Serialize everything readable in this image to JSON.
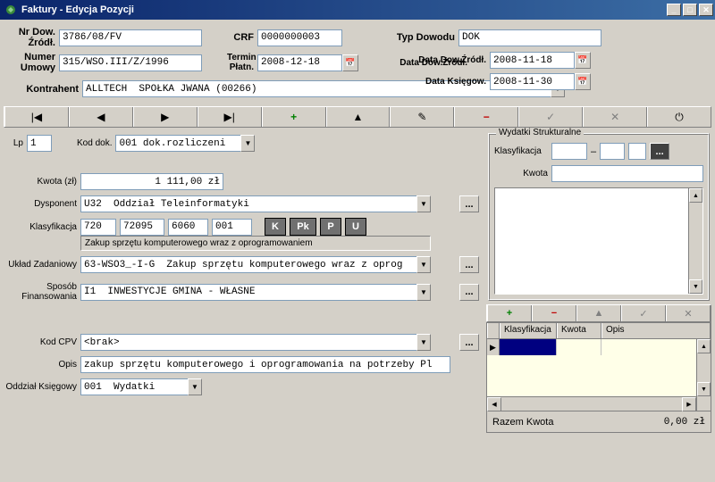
{
  "window": {
    "title": "Faktury - Edycja Pozycji"
  },
  "header": {
    "nrdow_label": "Nr Dow. Źródł.",
    "nrdow_value": "3786/08/FV",
    "crf_label": "CRF",
    "crf_value": "0000000003",
    "typdow_label": "Typ Dowodu",
    "typdow_value": "DOK",
    "numumowy_label": "Numer Umowy",
    "numumowy_value": "315/WSO.III/Z/1996",
    "termin_label": "Termin Płatn.",
    "termin_value": "2008-12-18",
    "datadow_label": "Data Dow.Źródł.",
    "datadow_value": "2008-11-18",
    "dataksieg_label": "Data Księgow.",
    "dataksieg_value": "2008-11-30",
    "kontrahent_label": "Kontrahent",
    "kontrahent_value": "ALLTECH  SPÓŁKA JWANA (00266)"
  },
  "toolbar": {
    "first": "⏮",
    "prev": "◀",
    "next": "▶",
    "last": "⏭",
    "add": "+",
    "up": "▲",
    "edit": "✎",
    "delete": "−",
    "ok": "✓",
    "cancel": "✕",
    "exit": "⎋"
  },
  "form": {
    "lp_label": "Lp",
    "lp_value": "1",
    "koddok_label": "Kod dok.",
    "koddok_value": "001 dok.rozliczeni",
    "kwota_label": "Kwota (zł)",
    "kwota_value": "1 111,00 zł",
    "dysponent_label": "Dysponent",
    "dysponent_value": "U32  Oddział Teleinformatyki",
    "klas_label": "Klasyfikacja",
    "klas_a": "720",
    "klas_b": "72095",
    "klas_c": "6060",
    "klas_d": "001",
    "klas_desc": "Zakup sprzętu komputerowego wraz z oprogramowaniem",
    "btn_K": "K",
    "btn_Pk": "Pk",
    "btn_P": "P",
    "btn_U": "U",
    "uklad_label": "Układ Zadaniowy",
    "uklad_value": "63-WSO3_-I-G  Zakup sprzętu komputerowego wraz z oprog",
    "sposob_label": "Sposób Finansowania",
    "sposob_value": "I1  INWESTYCJE GMINA - WŁASNE",
    "kodcpv_label": "Kod CPV",
    "kodcpv_value": "<brak>",
    "opis_label": "Opis",
    "opis_value": "zakup sprzętu komputerowego i oprogramowania na potrzeby Pl",
    "oddzial_label": "Oddział Księgowy",
    "oddzial_value": "001  Wydatki"
  },
  "side": {
    "group_title": "Wydatki Strukturalne",
    "klas_label": "Klasyfikacja",
    "dash": "–",
    "kwota_label": "Kwota",
    "grid_h1": "Klasyfikacja",
    "grid_h2": "Kwota",
    "grid_h3": "Opis",
    "total_label": "Razem Kwota",
    "total_value": "0,00 zł",
    "browse": "..."
  }
}
